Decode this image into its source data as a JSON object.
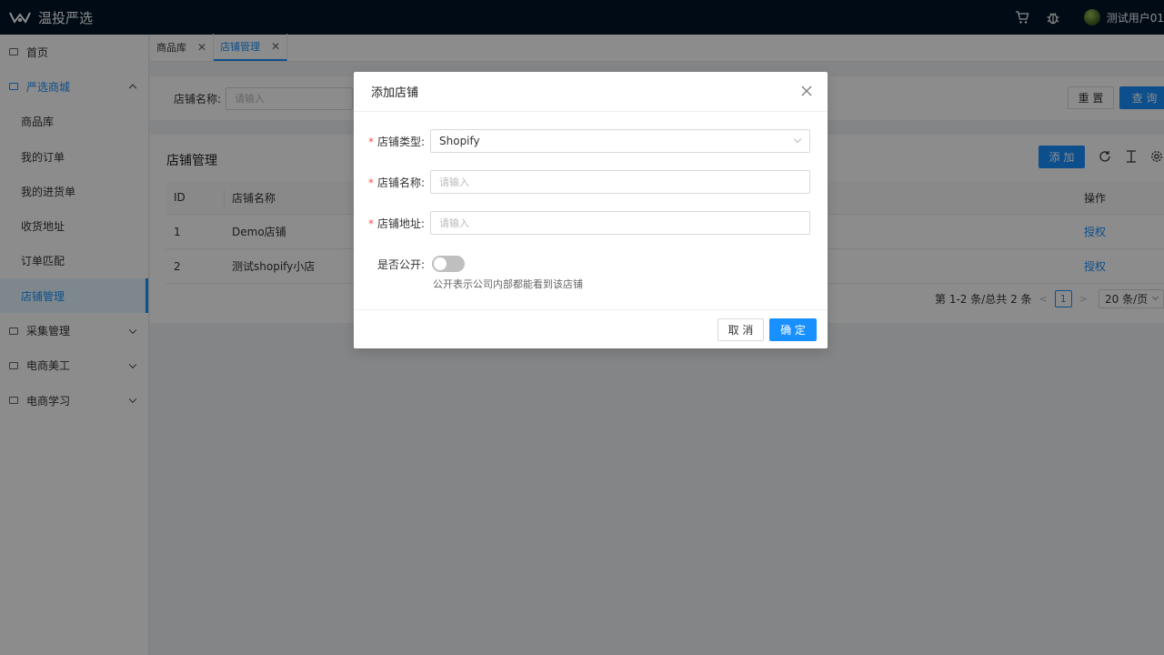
{
  "header": {
    "brand": "温投严选",
    "username": "测试用户01",
    "icons": [
      "cart-icon",
      "bug-icon"
    ]
  },
  "sidebar": {
    "items": [
      {
        "label": "首页",
        "icon": "folder-icon"
      },
      {
        "label": "严选商城",
        "icon": "folder-icon",
        "expanded": true
      },
      {
        "label": "商品库"
      },
      {
        "label": "我的订单"
      },
      {
        "label": "我的进货单"
      },
      {
        "label": "收货地址"
      },
      {
        "label": "订单匹配"
      },
      {
        "label": "店铺管理",
        "selected": true
      },
      {
        "label": "采集管理",
        "icon": "folder-icon"
      },
      {
        "label": "电商美工",
        "icon": "folder-icon"
      },
      {
        "label": "电商学习",
        "icon": "folder-icon"
      }
    ]
  },
  "tabs": [
    {
      "label": "商品库"
    },
    {
      "label": "店铺管理",
      "active": true
    }
  ],
  "filter": {
    "label": "店铺名称:",
    "placeholder": "请输入",
    "reset_label": "重 置",
    "query_label": "查 询"
  },
  "card": {
    "title": "店铺管理",
    "add_label": "添 加",
    "columns": {
      "id": "ID",
      "name": "店铺名称",
      "op": "操作"
    },
    "rows": [
      {
        "id": "1",
        "name": "Demo店铺",
        "op": "授权"
      },
      {
        "id": "2",
        "name": "测试shopify小店",
        "op": "授权"
      }
    ],
    "pagination": {
      "summary": "第 1-2 条/总共 2 条",
      "current_page": "1",
      "page_size": "20 条/页"
    }
  },
  "modal": {
    "title": "添加店铺",
    "type_label": "店铺类型:",
    "type_value": "Shopify",
    "name_label": "店铺名称:",
    "name_placeholder": "请输入",
    "address_label": "店铺地址:",
    "address_placeholder": "请输入",
    "public_label": "是否公开:",
    "public_on": false,
    "public_help": "公开表示公司内部都能看到该店铺",
    "cancel_label": "取 消",
    "ok_label": "确 定"
  },
  "colors": {
    "primary": "#1890ff",
    "header_bg": "#001529",
    "required": "#ff4d4f"
  }
}
